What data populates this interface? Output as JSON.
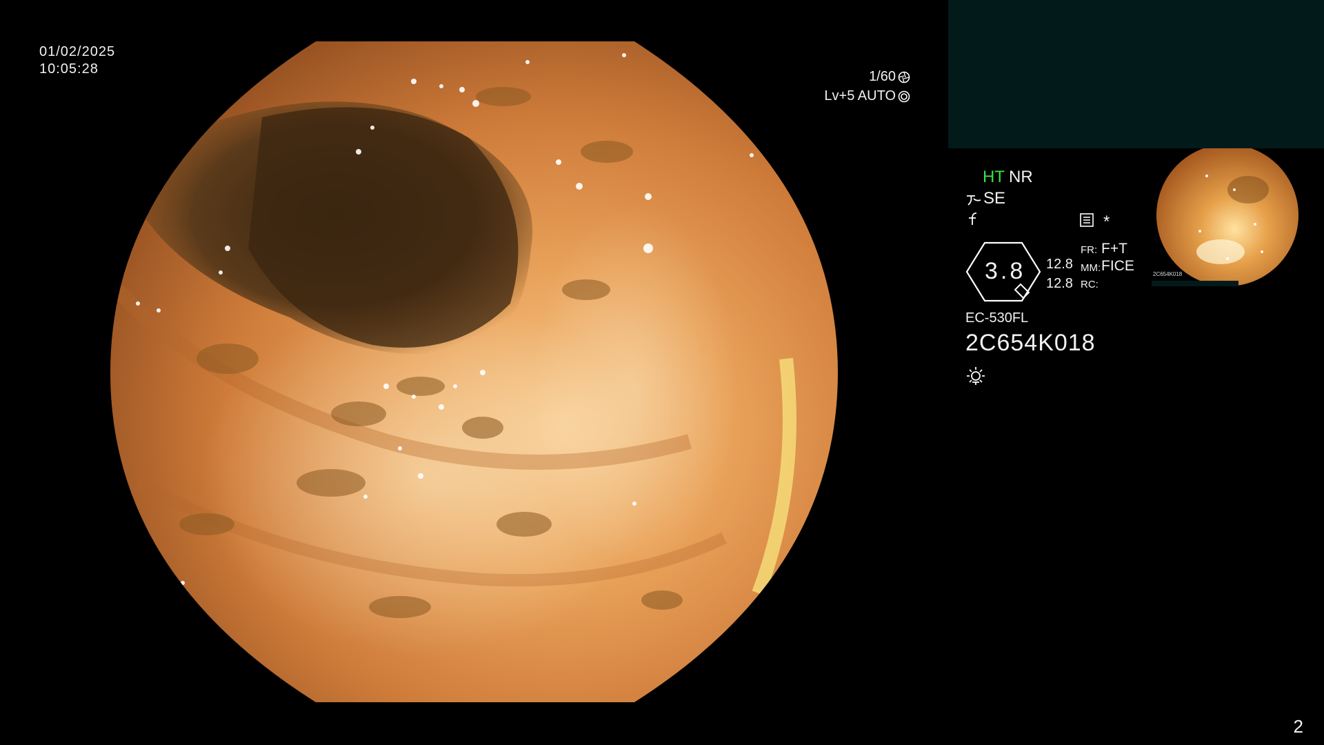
{
  "header": {
    "date": "01/02/2025",
    "time": "10:05:28",
    "shutter": "1/60",
    "level": "Lv+5 AUTO"
  },
  "status": {
    "ht": "HT",
    "nr": "NR",
    "se": "SE",
    "gauge_value": "3.8",
    "mm_top": "12.8",
    "mm_bottom": "12.8",
    "fr_label": "FR:",
    "fr_value": "F+T",
    "mm_label": "MM:",
    "mm_value": "FICE",
    "rc_label": "RC:",
    "asterisk": "*"
  },
  "scope": {
    "model": "EC-530FL",
    "serial": "2C654K018"
  },
  "thumbnail": {
    "serial": "2C654K018"
  },
  "footer": {
    "page_number": "2"
  },
  "colors": {
    "ht_green": "#3fe03f",
    "panel_teal": "#031a1a",
    "tissue_orange": "#e6963c"
  },
  "icons": [
    "shutter-icon",
    "auto-iris-icon",
    "structure-enhance-icon",
    "color-enhance-icon",
    "record-icon",
    "light-icon",
    "scale-gauge-icon"
  ]
}
